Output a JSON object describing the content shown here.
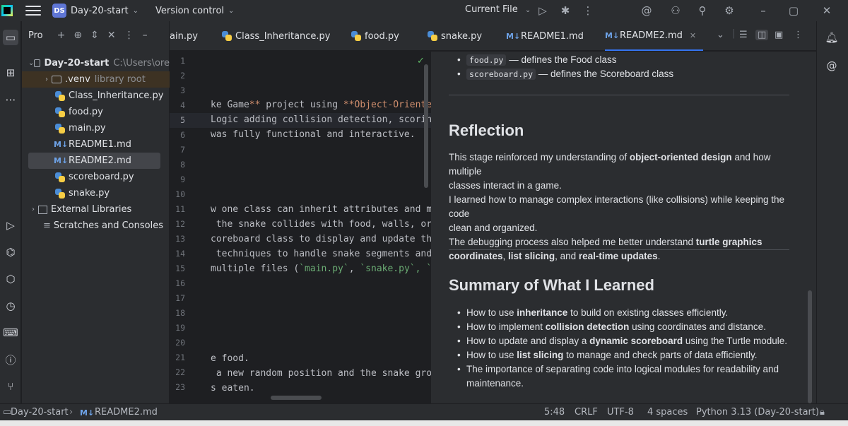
{
  "titlebar": {
    "project_badge": "DS",
    "project_name": "Day-20-start",
    "version_control": "Version control",
    "run_config": "Current File"
  },
  "project_panel": {
    "title": "Pro",
    "root": {
      "name": "Day-20-start",
      "path": "C:\\Users\\ore"
    },
    "items": [
      {
        "name": ".venv",
        "note": "library root",
        "type": "folder"
      },
      {
        "name": "Class_Inheritance.py",
        "type": "py"
      },
      {
        "name": "food.py",
        "type": "py"
      },
      {
        "name": "main.py",
        "type": "py"
      },
      {
        "name": "README1.md",
        "type": "md"
      },
      {
        "name": "README2.md",
        "type": "md"
      },
      {
        "name": "scoreboard.py",
        "type": "py"
      },
      {
        "name": "snake.py",
        "type": "py"
      }
    ],
    "external_libraries": "External Libraries",
    "scratches": "Scratches and Consoles"
  },
  "tabs": [
    {
      "label": "ain.py",
      "type": "py"
    },
    {
      "label": "Class_Inheritance.py",
      "type": "py"
    },
    {
      "label": "food.py",
      "type": "py"
    },
    {
      "label": "snake.py",
      "type": "py"
    },
    {
      "label": "README1.md",
      "type": "md"
    },
    {
      "label": "README2.md",
      "type": "md"
    }
  ],
  "editor": {
    "line_numbers": [
      "1",
      "2",
      "3",
      "4",
      "5",
      "6",
      "7",
      "8",
      "9",
      "10",
      "11",
      "12",
      "13",
      "14",
      "15",
      "16",
      "17",
      "18",
      "19",
      "20",
      "21",
      "22",
      "23"
    ],
    "lines": {
      "l4a": "ke Game",
      "l4b": "**",
      "l4c": " project using ",
      "l4d": "**Object-Oriente",
      "l5": "Logic adding collision detection, scorin",
      "l6": "was fully functional and interactive.",
      "l11": "w one class can inherit attributes and m",
      "l12": " the snake collides with food, walls, or",
      "l13": "coreboard class to display and update th",
      "l14": " techniques to handle snake segments and",
      "l15a": "multiple files (",
      "l15b": "`main.py`",
      "l15c": ", ",
      "l15d": "`snake.py`",
      "l15e": ", `",
      "l21": "e food.",
      "l22": " a new random position and the snake gro",
      "l23": "s eaten."
    }
  },
  "preview": {
    "top_items": [
      {
        "code": "food.py",
        "text": " — defines the Food class"
      },
      {
        "code": "scoreboard.py",
        "text": " — defines the Scoreboard class"
      }
    ],
    "reflection": {
      "heading": "Reflection",
      "p1a": "This stage reinforced my understanding of ",
      "p1b": "object-oriented design",
      "p1c": " and how multiple",
      "p1d": "classes interact in a game.",
      "p2a": "I learned how to manage complex interactions (like collisions) while keeping the code",
      "p2b": "clean and organized.",
      "p3a": "The debugging process also helped me better understand ",
      "p3b": "turtle graphics",
      "p3c": "coordinates",
      "p3d": ", ",
      "p3e": "list slicing",
      "p3f": ", and ",
      "p3g": "real-time updates",
      "p3h": "."
    },
    "summary": {
      "heading": "Summary of What I Learned",
      "items": [
        {
          "a": "How to use ",
          "b": "inheritance",
          "c": " to build on existing classes efficiently."
        },
        {
          "a": "How to implement ",
          "b": "collision detection",
          "c": " using coordinates and distance."
        },
        {
          "a": "How to update and display a ",
          "b": "dynamic scoreboard",
          "c": " using the Turtle module."
        },
        {
          "a": "How to use ",
          "b": "list slicing",
          "c": " to manage and check parts of data efficiently."
        },
        {
          "a": "The importance of separating code into logical modules for readability and",
          "b": "",
          "c": ""
        },
        {
          "a": "maintenance.",
          "b": "",
          "c": ""
        }
      ]
    }
  },
  "statusbar": {
    "breadcrumb_project": "Day-20-start",
    "breadcrumb_file": "README2.md",
    "position": "5:48",
    "line_ending": "CRLF",
    "encoding": "UTF-8",
    "indent": "4 spaces",
    "interpreter": "Python 3.13 (Day-20-start)"
  }
}
